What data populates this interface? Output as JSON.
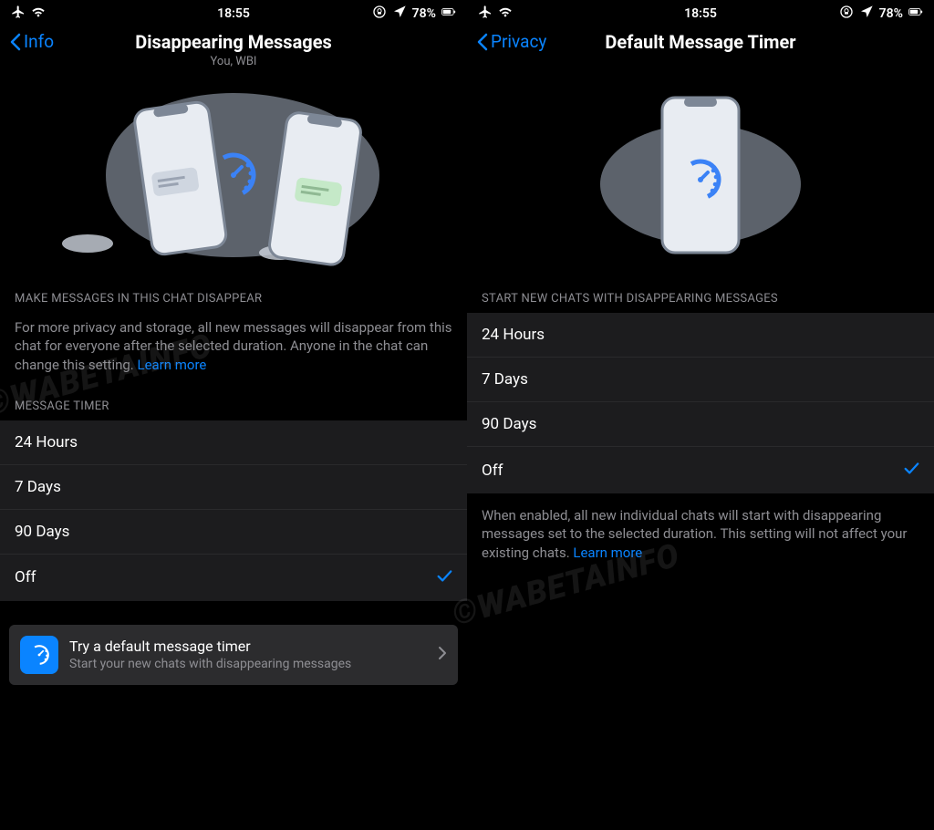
{
  "status": {
    "time": "18:55",
    "battery": "78%"
  },
  "left": {
    "back": "Info",
    "title": "Disappearing Messages",
    "subtitle": "You, WBI",
    "section1_header": "MAKE MESSAGES IN THIS CHAT DISAPPEAR",
    "section1_desc": "For more privacy and storage, all new messages will disappear from this chat for everyone after the selected duration. Anyone in the chat can change this setting. ",
    "learn_more": "Learn more",
    "section2_header": "MESSAGE TIMER",
    "options": [
      "24 Hours",
      "7 Days",
      "90 Days",
      "Off"
    ],
    "selected": "Off",
    "promo_title": "Try a default message timer",
    "promo_sub": "Start your new chats with disappearing messages"
  },
  "right": {
    "back": "Privacy",
    "title": "Default Message Timer",
    "section1_header": "START NEW CHATS WITH DISAPPEARING MESSAGES",
    "options": [
      "24 Hours",
      "7 Days",
      "90 Days",
      "Off"
    ],
    "selected": "Off",
    "footer_desc": "When enabled, all new individual chats will start with disappearing messages set to the selected duration. This setting will not affect your existing chats. ",
    "learn_more": "Learn more"
  },
  "watermark": "©WABETAINFO"
}
